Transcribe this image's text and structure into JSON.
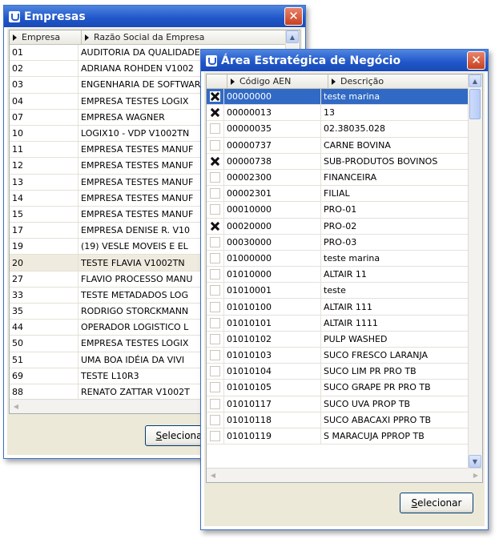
{
  "empresas_window": {
    "title": "Empresas",
    "columns": [
      "Empresa",
      "Razão Social da Empresa"
    ],
    "rows": [
      [
        "01",
        "AUDITORIA DA QUALIDADE"
      ],
      [
        "02",
        "ADRIANA ROHDEN V1002"
      ],
      [
        "03",
        "ENGENHARIA DE SOFTWARE"
      ],
      [
        "04",
        "EMPRESA TESTES LOGIX"
      ],
      [
        "07",
        "EMPRESA WAGNER"
      ],
      [
        "10",
        "LOGIX10 - VDP V1002TN"
      ],
      [
        "11",
        "EMPRESA TESTES MANUF"
      ],
      [
        "12",
        "EMPRESA TESTES MANUF"
      ],
      [
        "13",
        "EMPRESA TESTES MANUF"
      ],
      [
        "14",
        "EMPRESA TESTES MANUF"
      ],
      [
        "15",
        "EMPRESA TESTES MANUF"
      ],
      [
        "17",
        "EMPRESA DENISE R. V10"
      ],
      [
        "19",
        "(19) VESLE MOVEIS E EL"
      ],
      [
        "20",
        "TESTE FLAVIA V1002TN"
      ],
      [
        "27",
        "FLAVIO PROCESSO MANU"
      ],
      [
        "33",
        "TESTE METADADOS LOG"
      ],
      [
        "35",
        "RODRIGO STORCKMANN"
      ],
      [
        "44",
        "OPERADOR LOGISTICO L"
      ],
      [
        "50",
        "EMPRESA TESTES LOGIX"
      ],
      [
        "51",
        "UMA BOA IDÉIA DA VIVI"
      ],
      [
        "69",
        "TESTE L10R3"
      ],
      [
        "88",
        "RENATO ZATTAR V1002T"
      ]
    ],
    "highlighted_row": "20",
    "select_button": {
      "underlined": "S",
      "rest": "elecionar"
    }
  },
  "aen_window": {
    "title": "Área Estratégica de Negócio",
    "columns": [
      "Código AEN",
      "Descrição"
    ],
    "rows": [
      {
        "checked": true,
        "code": "00000000",
        "desc": "teste marina"
      },
      {
        "checked": true,
        "code": "00000013",
        "desc": "13"
      },
      {
        "checked": false,
        "code": "00000035",
        "desc": "02.38035.028"
      },
      {
        "checked": false,
        "code": "00000737",
        "desc": "CARNE BOVINA"
      },
      {
        "checked": true,
        "code": "00000738",
        "desc": "SUB-PRODUTOS BOVINOS"
      },
      {
        "checked": false,
        "code": "00002300",
        "desc": "FINANCEIRA"
      },
      {
        "checked": false,
        "code": "00002301",
        "desc": "FILIAL"
      },
      {
        "checked": false,
        "code": "00010000",
        "desc": "PRO-01"
      },
      {
        "checked": true,
        "code": "00020000",
        "desc": "PRO-02"
      },
      {
        "checked": false,
        "code": "00030000",
        "desc": "PRO-03"
      },
      {
        "checked": false,
        "code": "01000000",
        "desc": "teste marina"
      },
      {
        "checked": false,
        "code": "01010000",
        "desc": "ALTAIR 11"
      },
      {
        "checked": false,
        "code": "01010001",
        "desc": "teste"
      },
      {
        "checked": false,
        "code": "01010100",
        "desc": "ALTAIR 111"
      },
      {
        "checked": false,
        "code": "01010101",
        "desc": "ALTAIR 1111"
      },
      {
        "checked": false,
        "code": "01010102",
        "desc": "PULP WASHED"
      },
      {
        "checked": false,
        "code": "01010103",
        "desc": "SUCO FRESCO LARANJA"
      },
      {
        "checked": false,
        "code": "01010104",
        "desc": "SUCO LIM PR PRO TB"
      },
      {
        "checked": false,
        "code": "01010105",
        "desc": "SUCO GRAPE PR PRO TB"
      },
      {
        "checked": false,
        "code": "01010117",
        "desc": "SUCO UVA PROP TB"
      },
      {
        "checked": false,
        "code": "01010118",
        "desc": "SUCO ABACAXI PPRO TB"
      },
      {
        "checked": false,
        "code": "01010119",
        "desc": "S MARACUJA PPROP TB"
      }
    ],
    "selected_row": "00000000",
    "select_button": {
      "underlined": "S",
      "rest": "elecionar"
    }
  },
  "colors": {
    "title_bar": "#1f55c8",
    "selection": "#316ac5",
    "close_button": "#c8401f"
  },
  "icons": [
    "app-icon",
    "close-icon",
    "sort-arrow-icon",
    "scroll-up-icon",
    "scroll-down-icon",
    "scroll-left-icon",
    "scroll-right-icon",
    "checkbox-x-icon"
  ]
}
